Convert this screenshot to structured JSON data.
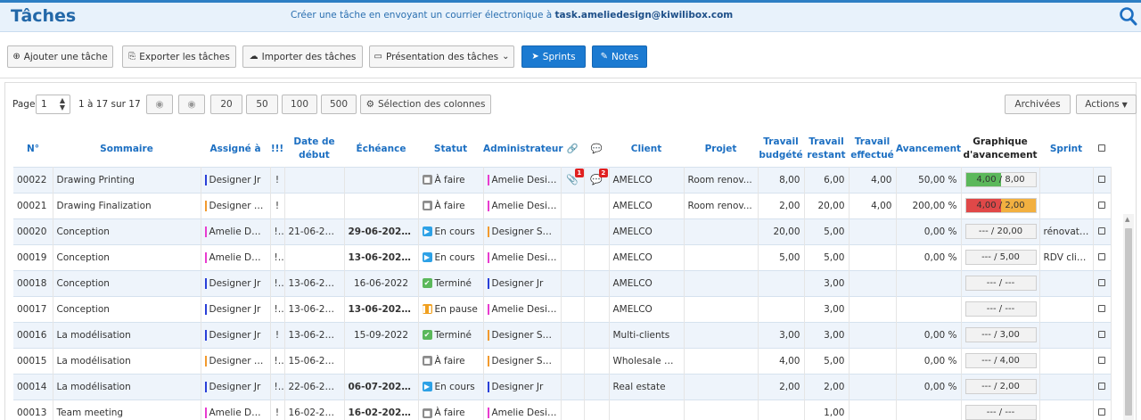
{
  "header": {
    "title": "Tâches",
    "mail_text": "Créer une tâche en envoyant un courrier électronique à",
    "mail_address": "task.ameliedesign@kiwilibox.com"
  },
  "toolbar": {
    "add": "Ajouter une tâche",
    "export": "Exporter les tâches",
    "import": "Importer des tâches",
    "presentation": "Présentation des tâches",
    "sprints": "Sprints",
    "notes": "Notes"
  },
  "pager": {
    "label": "Page",
    "current": "1",
    "range": "1 à 17 sur 17",
    "sizes": [
      "20",
      "50",
      "100",
      "500"
    ],
    "columns_button": "Sélection des colonnes",
    "archived": "Archivées",
    "actions": "Actions"
  },
  "columns": {
    "num": "N°",
    "summary": "Sommaire",
    "assigned": "Assigné à",
    "priority": "!!!",
    "start_1": "Date de",
    "start_2": "début",
    "due": "Échéance",
    "status": "Statut",
    "admin": "Administrateur",
    "client": "Client",
    "project": "Projet",
    "budget_1": "Travail",
    "budget_2": "budgété",
    "remaining_1": "Travail",
    "remaining_2": "restant",
    "done_1": "Travail",
    "done_2": "effectué",
    "progress": "Avancement",
    "graph_1": "Graphique",
    "graph_2": "d'avancement",
    "sprint": "Sprint"
  },
  "colors": {
    "accent": "#1c6fc2",
    "todo": "#8c8c8c",
    "in_progress": "#2da1e6",
    "done": "#5bb85b",
    "paused": "#f0a020",
    "admin_pink": "#e83ccf",
    "admin_orange": "#f29a2e",
    "admin_blue": "#2a3fd8"
  },
  "rows": [
    {
      "num": "00022",
      "summary": "Drawing Printing",
      "assigned": "Designer Jr",
      "assigned_color": "#2a3fd8",
      "priority": "!",
      "start": "",
      "due": "",
      "due_bold": false,
      "warn": false,
      "status": "À faire",
      "status_type": "todo",
      "admin": "Amelie Design",
      "admin_color": "#e83ccf",
      "attach_badge": "1",
      "comment_badge": "2",
      "client": "AMELCO",
      "project": "Room renov...",
      "budget": "8,00",
      "remaining": "6,00",
      "done": "4,00",
      "progress": "50,00 %",
      "graph_text": "4,00 / 8,00",
      "graph_fill": 0.5,
      "graph_color": "#5bb85b",
      "sprint": ""
    },
    {
      "num": "00021",
      "summary": "Drawing Finalization",
      "assigned": "Designer Se...",
      "assigned_color": "#f29a2e",
      "priority": "!",
      "start": "",
      "due": "",
      "due_bold": false,
      "warn": false,
      "status": "À faire",
      "status_type": "todo",
      "admin": "Amelie Design",
      "admin_color": "#e83ccf",
      "attach_badge": "",
      "comment_badge": "",
      "client": "AMELCO",
      "project": "Room renov...",
      "budget": "2,00",
      "remaining": "20,00",
      "done": "4,00",
      "progress": "200,00 %",
      "graph_text": "4,00 / 2,00",
      "graph_fill": 0.5,
      "graph_color": "#e04848",
      "graph_fill2": 0.5,
      "graph_color2": "#f2b040",
      "sprint": ""
    },
    {
      "num": "00020",
      "summary": "Conception",
      "assigned": "Amelie Desi...",
      "assigned_color": "#e83ccf",
      "priority": "!!!",
      "start": "21-06-2022",
      "due": "29-06-2022",
      "due_bold": true,
      "warn": true,
      "status": "En cours",
      "status_type": "in_progress",
      "admin": "Designer Sen...",
      "admin_color": "#f29a2e",
      "attach_badge": "",
      "comment_badge": "",
      "client": "AMELCO",
      "project": "",
      "budget": "20,00",
      "remaining": "5,00",
      "done": "",
      "progress": "0,00 %",
      "graph_text": "--- / 20,00",
      "graph_fill": 0,
      "graph_color": "",
      "sprint": "rénovation"
    },
    {
      "num": "00019",
      "summary": "Conception",
      "assigned": "Amelie Desi...",
      "assigned_color": "#e83ccf",
      "priority": "!!!",
      "start": "",
      "due": "13-06-2022",
      "due_bold": true,
      "warn": true,
      "status": "En cours",
      "status_type": "in_progress",
      "admin": "Amelie Design",
      "admin_color": "#e83ccf",
      "attach_badge": "",
      "comment_badge": "",
      "client": "AMELCO",
      "project": "",
      "budget": "5,00",
      "remaining": "5,00",
      "done": "",
      "progress": "0,00 %",
      "graph_text": "--- / 5,00",
      "graph_fill": 0,
      "graph_color": "",
      "sprint": "RDV client"
    },
    {
      "num": "00018",
      "summary": "Conception",
      "assigned": "Designer Jr",
      "assigned_color": "#2a3fd8",
      "priority": "!!",
      "start": "13-06-2022",
      "due": "16-06-2022",
      "due_bold": false,
      "warn": false,
      "status": "Terminé",
      "status_type": "done",
      "admin": "Designer Jr",
      "admin_color": "#2a3fd8",
      "attach_badge": "",
      "comment_badge": "",
      "client": "AMELCO",
      "project": "",
      "budget": "",
      "remaining": "3,00",
      "done": "",
      "progress": "",
      "graph_text": "--- / ---",
      "graph_fill": 0,
      "graph_color": "",
      "sprint": ""
    },
    {
      "num": "00017",
      "summary": "Conception",
      "assigned": "Designer Jr",
      "assigned_color": "#2a3fd8",
      "priority": "!!",
      "start": "13-06-2022",
      "due": "13-06-2022",
      "due_bold": true,
      "warn": true,
      "status": "En pause",
      "status_type": "paused",
      "admin": "Amelie Design",
      "admin_color": "#e83ccf",
      "attach_badge": "",
      "comment_badge": "",
      "client": "AMELCO",
      "project": "",
      "budget": "",
      "remaining": "3,00",
      "done": "",
      "progress": "",
      "graph_text": "--- / ---",
      "graph_fill": 0,
      "graph_color": "",
      "sprint": ""
    },
    {
      "num": "00016",
      "summary": "La modélisation",
      "assigned": "Designer Jr",
      "assigned_color": "#2a3fd8",
      "priority": "!",
      "start": "13-06-2022",
      "due": "15-09-2022",
      "due_bold": false,
      "warn": false,
      "status": "Terminé",
      "status_type": "done",
      "admin": "Designer Sen...",
      "admin_color": "#f29a2e",
      "attach_badge": "",
      "comment_badge": "",
      "client": "Multi-clients",
      "project": "",
      "budget": "3,00",
      "remaining": "3,00",
      "done": "",
      "progress": "0,00 %",
      "graph_text": "--- / 3,00",
      "graph_fill": 0,
      "graph_color": "",
      "sprint": ""
    },
    {
      "num": "00015",
      "summary": "La modélisation",
      "assigned": "Designer Se...",
      "assigned_color": "#f29a2e",
      "priority": "!!",
      "start": "15-06-2022",
      "due": "",
      "due_bold": false,
      "warn": false,
      "status": "À faire",
      "status_type": "todo",
      "admin": "Designer Sen...",
      "admin_color": "#f29a2e",
      "attach_badge": "",
      "comment_badge": "",
      "client": "Wholesale O...",
      "project": "",
      "budget": "4,00",
      "remaining": "5,00",
      "done": "",
      "progress": "0,00 %",
      "graph_text": "--- / 4,00",
      "graph_fill": 0,
      "graph_color": "",
      "sprint": ""
    },
    {
      "num": "00014",
      "summary": "La modélisation",
      "assigned": "Designer Jr",
      "assigned_color": "#2a3fd8",
      "priority": "!!!",
      "start": "22-06-2022",
      "due": "06-07-2022",
      "due_bold": true,
      "warn": true,
      "status": "En cours",
      "status_type": "in_progress",
      "admin": "Designer Jr",
      "admin_color": "#2a3fd8",
      "attach_badge": "",
      "comment_badge": "",
      "client": "Real estate",
      "project": "",
      "budget": "2,00",
      "remaining": "2,00",
      "done": "",
      "progress": "0,00 %",
      "graph_text": "--- / 2,00",
      "graph_fill": 0,
      "graph_color": "",
      "sprint": ""
    },
    {
      "num": "00013",
      "summary": "Team meeting",
      "assigned": "Amelie Desi...",
      "assigned_color": "#e83ccf",
      "priority": "!",
      "start": "16-02-2022",
      "due": "16-02-2022",
      "due_bold": true,
      "warn": true,
      "status": "À faire",
      "status_type": "todo",
      "admin": "Amelie Design",
      "admin_color": "#e83ccf",
      "attach_badge": "",
      "comment_badge": "",
      "client": "",
      "project": "",
      "budget": "",
      "remaining": "1,00",
      "done": "",
      "progress": "",
      "graph_text": "--- / ---",
      "graph_fill": 0,
      "graph_color": "",
      "sprint": ""
    }
  ]
}
